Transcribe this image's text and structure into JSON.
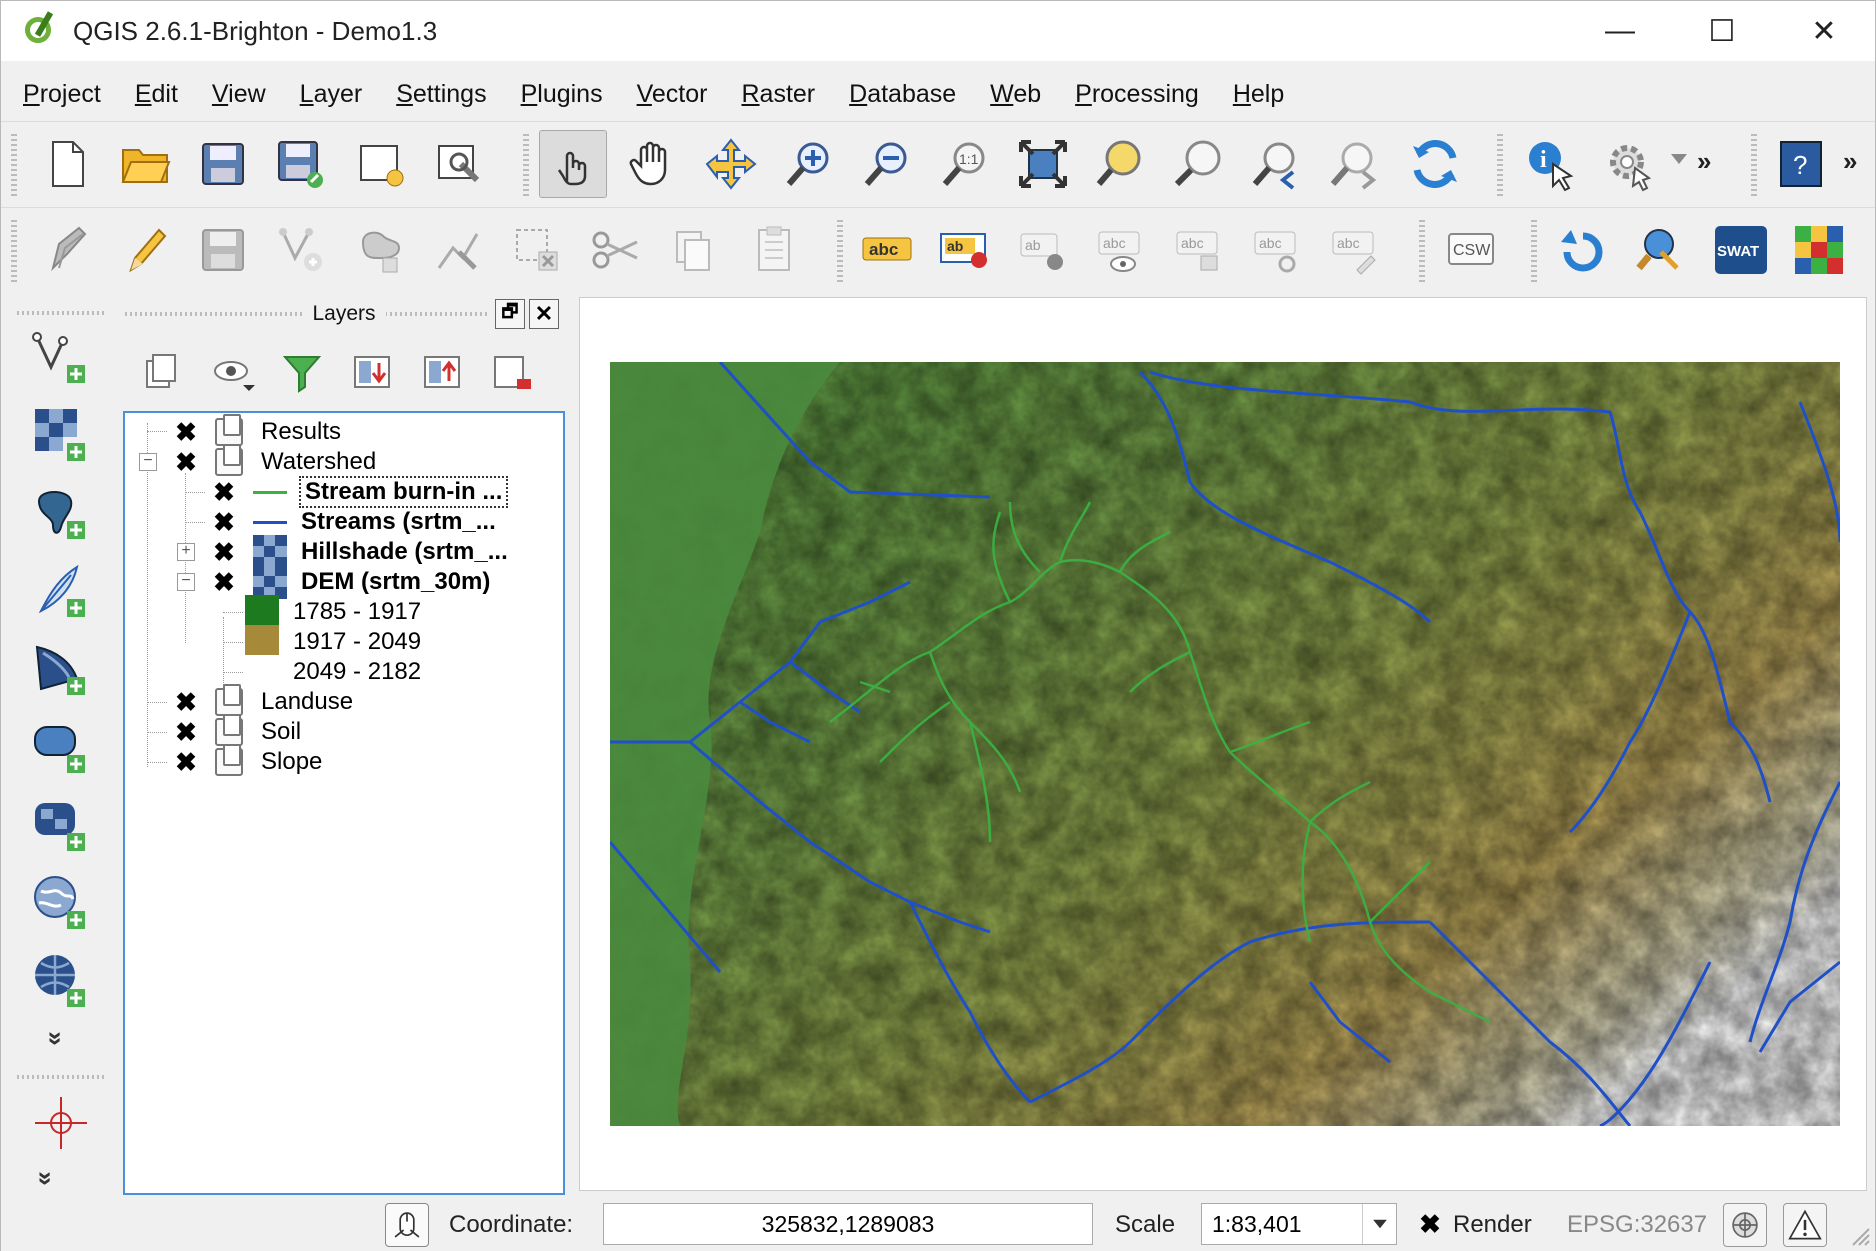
{
  "window": {
    "title": "QGIS 2.6.1-Brighton - Demo1.3",
    "minimize": "—",
    "maximize": "☐",
    "close": "✕"
  },
  "menu": [
    "Project",
    "Edit",
    "View",
    "Layer",
    "Settings",
    "Plugins",
    "Vector",
    "Raster",
    "Database",
    "Web",
    "Processing",
    "Help"
  ],
  "toolbar_labels": {
    "abc": "abc",
    "ab": "ab",
    "csw": "CSW",
    "swat": "SWAT",
    "overflow": "»",
    "vert_overflow": "»"
  },
  "layers_panel": {
    "title": "Layers",
    "float_button": "🗗",
    "close_button": "✕",
    "items": [
      {
        "name": "Results",
        "checked": "✖"
      },
      {
        "name": "Watershed",
        "checked": "✖"
      },
      {
        "name": "Stream burn-in ...",
        "checked": "✖"
      },
      {
        "name": "Streams (srtm_...",
        "checked": "✖"
      },
      {
        "name": "Hillshade (srtm_...",
        "checked": "✖"
      },
      {
        "name": "DEM (srtm_30m)",
        "checked": "✖"
      },
      {
        "name": "Landuse",
        "checked": "✖"
      },
      {
        "name": "Soil",
        "checked": "✖"
      },
      {
        "name": "Slope",
        "checked": "✖"
      }
    ],
    "legend": [
      {
        "label": "1785 - 1917",
        "color": "#1e7a1e"
      },
      {
        "label": "1917 - 2049",
        "color": "#a68a3a"
      },
      {
        "label": "2049 - 2182",
        "color": "#ffffff"
      }
    ],
    "expand_plus": "+",
    "expand_minus": "−"
  },
  "statusbar": {
    "coordinate_label": "Coordinate:",
    "coordinate_value": "325832,1289083",
    "scale_label": "Scale",
    "scale_value": "1:83,401",
    "render_check": "✖",
    "render_label": "Render",
    "crs": "EPSG:32637"
  },
  "colors": {
    "stream_burn": "#3cb043",
    "streams": "#2050c8"
  }
}
